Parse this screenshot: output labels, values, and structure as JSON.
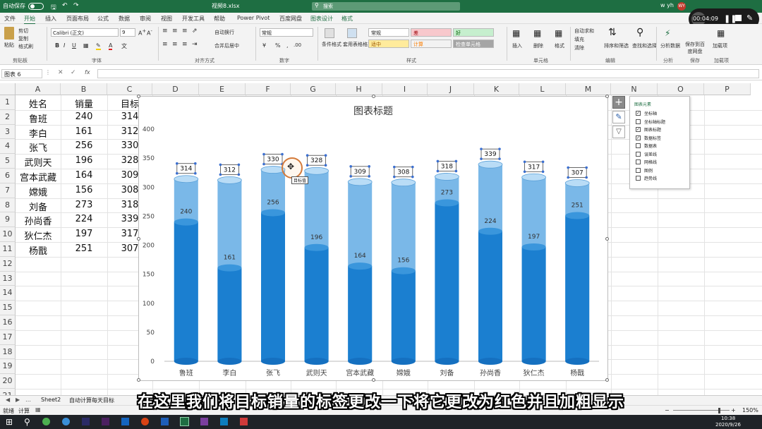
{
  "titlebar": {
    "autosave_label": "自动保存",
    "toggle_state": "关",
    "filename": "视频8.xlsx",
    "search_placeholder": "搜索",
    "user": "w yh",
    "user_initials": "WY"
  },
  "tabs": [
    "文件",
    "开始",
    "插入",
    "页面布局",
    "公式",
    "数据",
    "审阅",
    "视图",
    "开发工具",
    "帮助",
    "Power Pivot",
    "百度网盘",
    "图表设计",
    "格式"
  ],
  "active_tab": "开始",
  "ribbon": {
    "paste_label": "粘贴",
    "cut_label": "剪切",
    "copy_label": "复制",
    "format_painter_label": "格式刷",
    "font_name": "Calibri (正文)",
    "font_size": "9",
    "wrap_text_label": "自动换行",
    "merge_label": "合并后居中",
    "number_format": "常规",
    "conditional_format_label": "条件格式",
    "table_format_label": "套用表格格式",
    "styles": {
      "normal": "常规",
      "bad": "差",
      "good": "好",
      "neutral": "适中",
      "calc": "计算",
      "check": "检查单元格"
    },
    "insert_label": "插入",
    "delete_label": "删除",
    "format_label": "格式",
    "autosum_label": "自动求和",
    "fill_label": "填充",
    "clear_label": "清除",
    "sort_filter_label": "排序和筛选",
    "find_select_label": "查找和选择",
    "analyze_label": "分析数据",
    "save_baidu_label": "保存到百度网盘",
    "plugin_label": "加载项",
    "groups": {
      "clipboard": "剪贴板",
      "font": "字体",
      "alignment": "对齐方式",
      "number": "数字",
      "styles": "样式",
      "cells": "单元格",
      "editing": "编辑",
      "analysis": "分析",
      "save": "保存",
      "plugins": "加载项"
    }
  },
  "recorder": {
    "time": "00:04:09"
  },
  "formula_bar": {
    "name_box": "图表 6",
    "fx": "fx",
    "formula": ""
  },
  "columns": [
    "A",
    "B",
    "C",
    "D",
    "E",
    "F",
    "G",
    "H",
    "I",
    "J",
    "K",
    "L",
    "M",
    "N",
    "O",
    "P"
  ],
  "rows": [
    "1",
    "2",
    "3",
    "4",
    "5",
    "6",
    "7",
    "8",
    "9",
    "10",
    "11",
    "12",
    "13",
    "14",
    "15",
    "16",
    "17",
    "18",
    "19",
    "20",
    "21",
    "22"
  ],
  "table": {
    "headers": [
      "姓名",
      "销量",
      "目标"
    ],
    "rows": [
      [
        "鲁班",
        "240",
        "314"
      ],
      [
        "李白",
        "161",
        "312"
      ],
      [
        "张飞",
        "256",
        "330"
      ],
      [
        "武则天",
        "196",
        "328"
      ],
      [
        "宫本武藏",
        "164",
        "309"
      ],
      [
        "嫦娥",
        "156",
        "308"
      ],
      [
        "刘备",
        "273",
        "318"
      ],
      [
        "孙尚香",
        "224",
        "339"
      ],
      [
        "狄仁杰",
        "197",
        "317"
      ],
      [
        "杨戬",
        "251",
        "307"
      ]
    ]
  },
  "chart_data": {
    "type": "bar",
    "title": "图表标题",
    "categories": [
      "鲁班",
      "李白",
      "张飞",
      "武则天",
      "宫本武藏",
      "嫦娥",
      "刘备",
      "孙尚香",
      "狄仁杰",
      "杨戬"
    ],
    "series": [
      {
        "values": [
          240,
          161,
          256,
          196,
          164,
          156,
          273,
          224,
          197,
          251
        ]
      },
      {
        "values": [
          314,
          312,
          330,
          328,
          309,
          308,
          318,
          339,
          317,
          307
        ]
      }
    ],
    "ylim": [
      0,
      400
    ],
    "yticks": [
      0,
      50,
      100,
      150,
      200,
      250,
      300,
      350,
      400
    ],
    "grid": false,
    "legend": "none",
    "colors": {
      "actual": "#1b7fd0",
      "target": "#7ab8e8",
      "label_border": "#444444"
    }
  },
  "chart_tooltip": "目标值",
  "chart_elements_panel": {
    "title": "图表元素",
    "items": [
      {
        "label": "坐标轴",
        "checked": true
      },
      {
        "label": "坐标轴标题",
        "checked": false
      },
      {
        "label": "图表标题",
        "checked": true
      },
      {
        "label": "数据标签",
        "checked": true
      },
      {
        "label": "数据表",
        "checked": false
      },
      {
        "label": "误差线",
        "checked": false
      },
      {
        "label": "网格线",
        "checked": false
      },
      {
        "label": "图例",
        "checked": false
      },
      {
        "label": "趋势线",
        "checked": false
      }
    ]
  },
  "sheet_tabs": [
    "Sheet2",
    "自动计算每天目标"
  ],
  "status": {
    "mode": "就绪",
    "accessibility": "计算",
    "zoom": "150%"
  },
  "taskbar": {
    "time": "10:38",
    "date": "2020/9/26"
  },
  "subtitle": "在这里我们将目标销量的标签更改一下将它更改为红色并且加粗显示"
}
